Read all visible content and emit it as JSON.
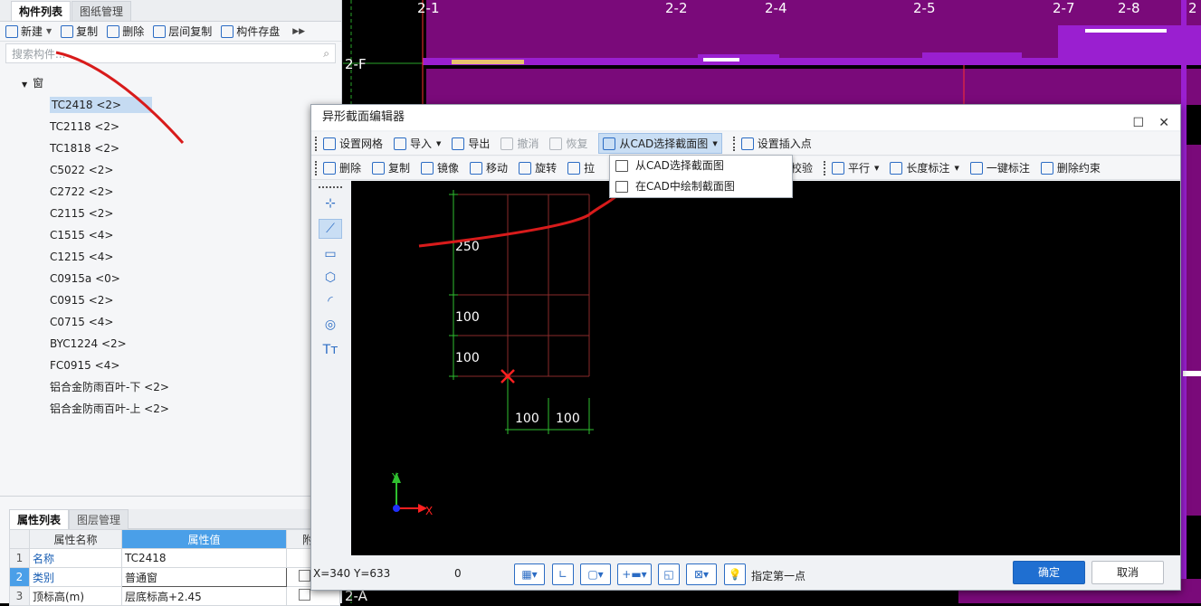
{
  "left_panel": {
    "tabs": [
      "构件列表",
      "图纸管理"
    ],
    "toolbar": [
      {
        "label": "新建",
        "icon": "new-icon"
      },
      {
        "label": "复制",
        "icon": "copy-icon"
      },
      {
        "label": "删除",
        "icon": "delete-icon"
      },
      {
        "label": "层间复制",
        "icon": "layer-copy-icon"
      },
      {
        "label": "构件存盘",
        "icon": "save-icon"
      }
    ],
    "search_placeholder": "搜索构件...",
    "tree_root": "窗",
    "tree_items": [
      "TC2418 <2>",
      "TC2118 <2>",
      "TC1818 <2>",
      "C5022 <2>",
      "C2722 <2>",
      "C2115 <2>",
      "C1515 <4>",
      "C1215 <4>",
      "C0915a <0>",
      "C0915 <2>",
      "C0715 <4>",
      "BYC1224 <2>",
      "FC0915 <4>",
      "铝合金防雨百叶-下 <2>",
      "铝合金防雨百叶-上 <2>"
    ],
    "selected_index": 0,
    "prop_tabs": [
      "属性列表",
      "图层管理"
    ],
    "prop_headers": [
      "属性名称",
      "属性值",
      "附加"
    ],
    "props": [
      {
        "num": "1",
        "name": "名称",
        "value": "TC2418"
      },
      {
        "num": "2",
        "name": "类别",
        "value": "普通窗"
      },
      {
        "num": "3",
        "name": "顶标高(m)",
        "value": "层底标高+2.45"
      }
    ]
  },
  "cad_labels": [
    "2-1",
    "2-2",
    "2-4",
    "2-5",
    "2-7",
    "2-8",
    "2",
    "2-F",
    "2-A"
  ],
  "dialog": {
    "title": "异形截面编辑器",
    "toolbar1": [
      {
        "label": "设置网格",
        "icon": "grid-icon",
        "disabled": false
      },
      {
        "label": "导入",
        "icon": "import-icon",
        "disabled": false
      },
      {
        "label": "导出",
        "icon": "export-icon",
        "disabled": false
      },
      {
        "label": "撤消",
        "icon": "undo-icon",
        "disabled": true
      },
      {
        "label": "恢复",
        "icon": "redo-icon",
        "disabled": true
      },
      {
        "label": "从CAD选择截面图",
        "icon": "cad-select-icon",
        "disabled": false
      },
      {
        "label": "设置插入点",
        "icon": "insert-point-icon",
        "disabled": false
      }
    ],
    "toolbar2": [
      {
        "label": "删除",
        "icon": "delete-icon"
      },
      {
        "label": "复制",
        "icon": "copy-icon"
      },
      {
        "label": "镜像",
        "icon": "mirror-icon"
      },
      {
        "label": "移动",
        "icon": "move-icon"
      },
      {
        "label": "旋转",
        "icon": "rotate-icon"
      },
      {
        "label": "拉",
        "icon": "stretch-icon"
      }
    ],
    "toolbar2_right": [
      {
        "label": "校验",
        "icon": ""
      },
      {
        "label": "平行",
        "icon": "parallel-icon"
      },
      {
        "label": "长度标注",
        "icon": "length-dim-icon"
      },
      {
        "label": "一键标注",
        "icon": "auto-dim-icon"
      },
      {
        "label": "删除约束",
        "icon": "remove-constraint-icon"
      }
    ],
    "dropdown": [
      "从CAD选择截面图",
      "在CAD中绘制截面图"
    ],
    "dims": {
      "v1": "250",
      "v2": "100",
      "v3": "100",
      "h1": "100",
      "h2": "100"
    },
    "axis": {
      "x": "X",
      "y": "Y"
    },
    "status": {
      "coords": "X=340 Y=633",
      "zero": "0",
      "prompt": "指定第一点"
    },
    "buttons": {
      "ok": "确定",
      "cancel": "取消"
    }
  }
}
